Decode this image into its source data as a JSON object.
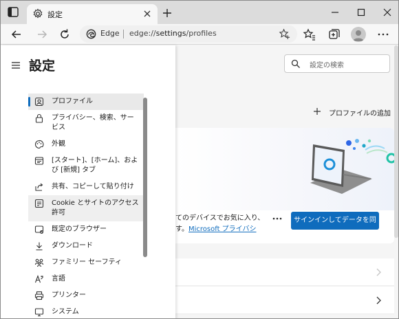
{
  "tab": {
    "title": "設定"
  },
  "toolbar": {
    "site_name": "Edge",
    "url_scheme": "edge://",
    "url_host": "settings",
    "url_path": "/profiles"
  },
  "sidebar": {
    "title": "設定",
    "items": [
      {
        "label": "プロファイル",
        "icon": "profile-icon",
        "selected": true
      },
      {
        "label": "プライバシー、検索、サービス",
        "icon": "lock-icon"
      },
      {
        "label": "外観",
        "icon": "palette-icon"
      },
      {
        "label": "[スタート]、[ホーム]、および [新規] タブ",
        "icon": "home-tabs-icon"
      },
      {
        "label": "共有、コピーして貼り付け",
        "icon": "share-icon"
      },
      {
        "label": "Cookie とサイトのアクセス許可",
        "icon": "site-permissions-icon",
        "hover": true
      },
      {
        "label": "既定のブラウザー",
        "icon": "default-browser-icon"
      },
      {
        "label": "ダウンロード",
        "icon": "download-icon"
      },
      {
        "label": "ファミリー セーフティ",
        "icon": "family-icon"
      },
      {
        "label": "言語",
        "icon": "language-icon"
      },
      {
        "label": "プリンター",
        "icon": "printer-icon"
      },
      {
        "label": "システム",
        "icon": "system-icon"
      }
    ]
  },
  "search": {
    "placeholder": "設定の検索"
  },
  "main": {
    "add_profile_label": "プロファイルの追加",
    "card_line1": "てのデバイスでお気に入り、",
    "card_line2_prefix": "す。",
    "card_link": "Microsoft プライバシ",
    "signin_label": "サインインしてデータを同期"
  },
  "colors": {
    "accent": "#0f6cbd"
  }
}
